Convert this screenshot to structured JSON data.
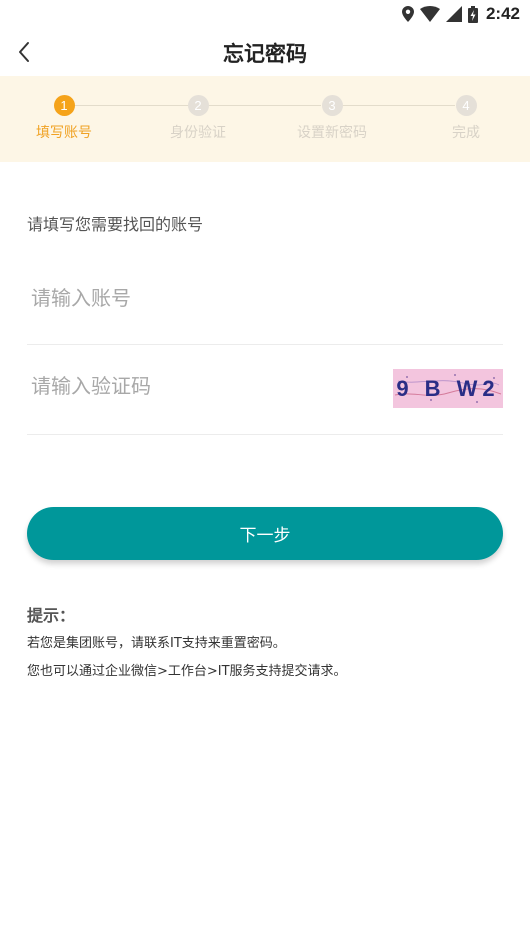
{
  "status_bar": {
    "time": "2:42",
    "icons": [
      "location-icon",
      "wifi-icon",
      "signal-icon",
      "battery-charging-icon"
    ]
  },
  "header": {
    "back_icon": "chevron-left-icon",
    "title": "忘记密码"
  },
  "stepper": {
    "active_step": 1,
    "steps": [
      {
        "number": "1",
        "label": "填写账号"
      },
      {
        "number": "2",
        "label": "身份验证"
      },
      {
        "number": "3",
        "label": "设置新密码"
      },
      {
        "number": "4",
        "label": "完成"
      }
    ]
  },
  "form": {
    "instruction": "请填写您需要找回的账号",
    "account_value": "",
    "account_placeholder": "请输入账号",
    "captcha_value": "",
    "captcha_placeholder": "请输入验证码",
    "captcha_text": "9 B W2",
    "next_label": "下一步"
  },
  "tips": {
    "title": "提示：",
    "line1": "若您是集团账号，请联系IT支持来重置密码。",
    "line2": "您也可以通过企业微信>工作台>IT服务支持提交请求。"
  },
  "colors": {
    "accent": "#00979a",
    "step_active": "#f5a31a",
    "step_inactive": "#e5e0d8",
    "stepper_bg": "#fdf6e6",
    "captcha_bg": "#f3c5de",
    "captcha_text": "#2a2e86"
  }
}
